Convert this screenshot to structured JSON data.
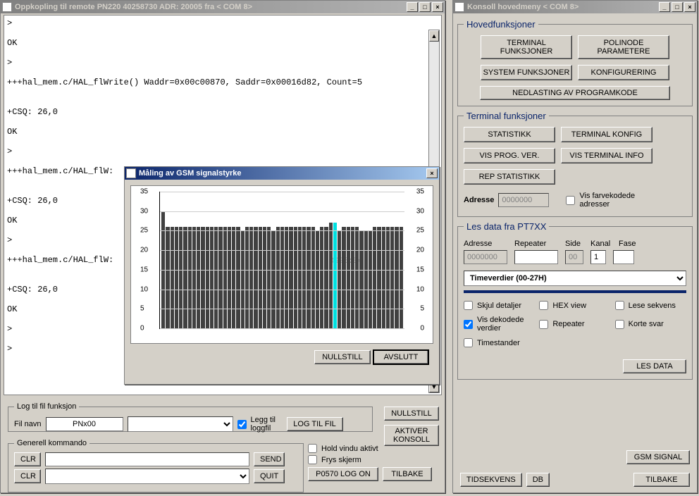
{
  "left_window": {
    "title": "Oppkopling til remote PN220 40258730 ADR: 20005   fra  < COM 8>",
    "console_text": ">\n\nOK\n\n>\n\n+++hal_mem.c/HAL_flWrite() Waddr=0x00c00870, Saddr=0x00016d82, Count=5\n\n\n+CSQ: 26,0\n\nOK\n\n>\n\n+++hal_mem.c/HAL_flW:\n\n\n+CSQ: 26,0\n\nOK\n\n>\n\n+++hal_mem.c/HAL_flW:\n\n\n+CSQ: 26,0\n\nOK\n\n>\n\n>"
  },
  "gsm_window": {
    "title": "Måling av GSM signalstyrke",
    "overlay": "0925:04",
    "btn_reset": "NULLSTILL",
    "btn_close": "AVSLUTT"
  },
  "log": {
    "legend": "Log til fil funksjon",
    "filename_label": "Fil navn",
    "filename_value": "PNx00",
    "append_label": "Legg til loggfil",
    "btn_log": "LOG TIL FIL"
  },
  "general": {
    "legend": "Generell kommando",
    "btn_clr": "CLR",
    "btn_send": "SEND",
    "btn_quit": "QUIT",
    "hold_label": "Hold vindu aktivt",
    "freeze_label": "Frys skjerm",
    "btn_logon": "P0570 LOG ON",
    "btn_back": "TILBAKE"
  },
  "side_btns": {
    "reset": "NULLSTILL",
    "activate": "AKTIVER KONSOLL"
  },
  "right_window": {
    "title": "Konsoll hovedmeny  < COM 8>",
    "main": {
      "legend": "Hovedfunksjoner",
      "b1": "TERMINAL FUNKSJONER",
      "b2": "POLINODE PARAMETERE",
      "b3": "SYSTEM FUNKSJONER",
      "b4": "KONFIGURERING",
      "b5": "NEDLASTING AV PROGRAMKODE"
    },
    "term": {
      "legend": "Terminal funksjoner",
      "b1": "STATISTIKK",
      "b2": "TERMINAL KONFIG",
      "b3": "VIS PROG. VER.",
      "b4": "VIS TERMINAL INFO",
      "b5": "REP STATISTIKK",
      "addr_label": "Adresse",
      "addr_value": "0000000",
      "color_label": "Vis farvekodede adresser"
    },
    "read": {
      "legend": "Les data fra PT7XX",
      "h_addr": "Adresse",
      "h_rep": "Repeater",
      "h_side": "Side",
      "h_kanal": "Kanal",
      "h_fase": "Fase",
      "v_addr": "0000000",
      "v_side": "00",
      "v_kanal": "1",
      "dropdown": "Timeverdier (00-27H)",
      "cb1": "Skjul detaljer",
      "cb2": "HEX view",
      "cb3": "Lese sekvens",
      "cb4": "Vis dekodede verdier",
      "cb5": "Repeater",
      "cb6": "Korte svar",
      "cb7": "Timestander",
      "btn_read": "LES DATA"
    },
    "bottom": {
      "b1": "TIDSEKVENS",
      "b2": "DB",
      "b3": "GSM SIGNAL",
      "b4": "TILBAKE"
    }
  },
  "chart_data": {
    "type": "bar",
    "title": "Måling av GSM signalstyrke",
    "ylabel_left": "",
    "ylabel_right": "",
    "ylim": [
      0,
      35
    ],
    "y_ticks": [
      0,
      5,
      10,
      15,
      20,
      25,
      30,
      35
    ],
    "highlight_index": 39,
    "values": [
      30,
      26,
      26,
      26,
      26,
      26,
      26,
      26,
      26,
      26,
      26,
      26,
      26,
      26,
      26,
      26,
      26,
      26,
      25,
      26,
      26,
      26,
      26,
      26,
      26,
      25,
      26,
      26,
      26,
      26,
      26,
      26,
      26,
      26,
      26,
      25,
      26,
      26,
      27,
      27,
      25,
      26,
      26,
      26,
      26,
      25,
      25,
      25,
      26,
      26,
      26,
      26,
      26,
      26,
      26
    ]
  }
}
